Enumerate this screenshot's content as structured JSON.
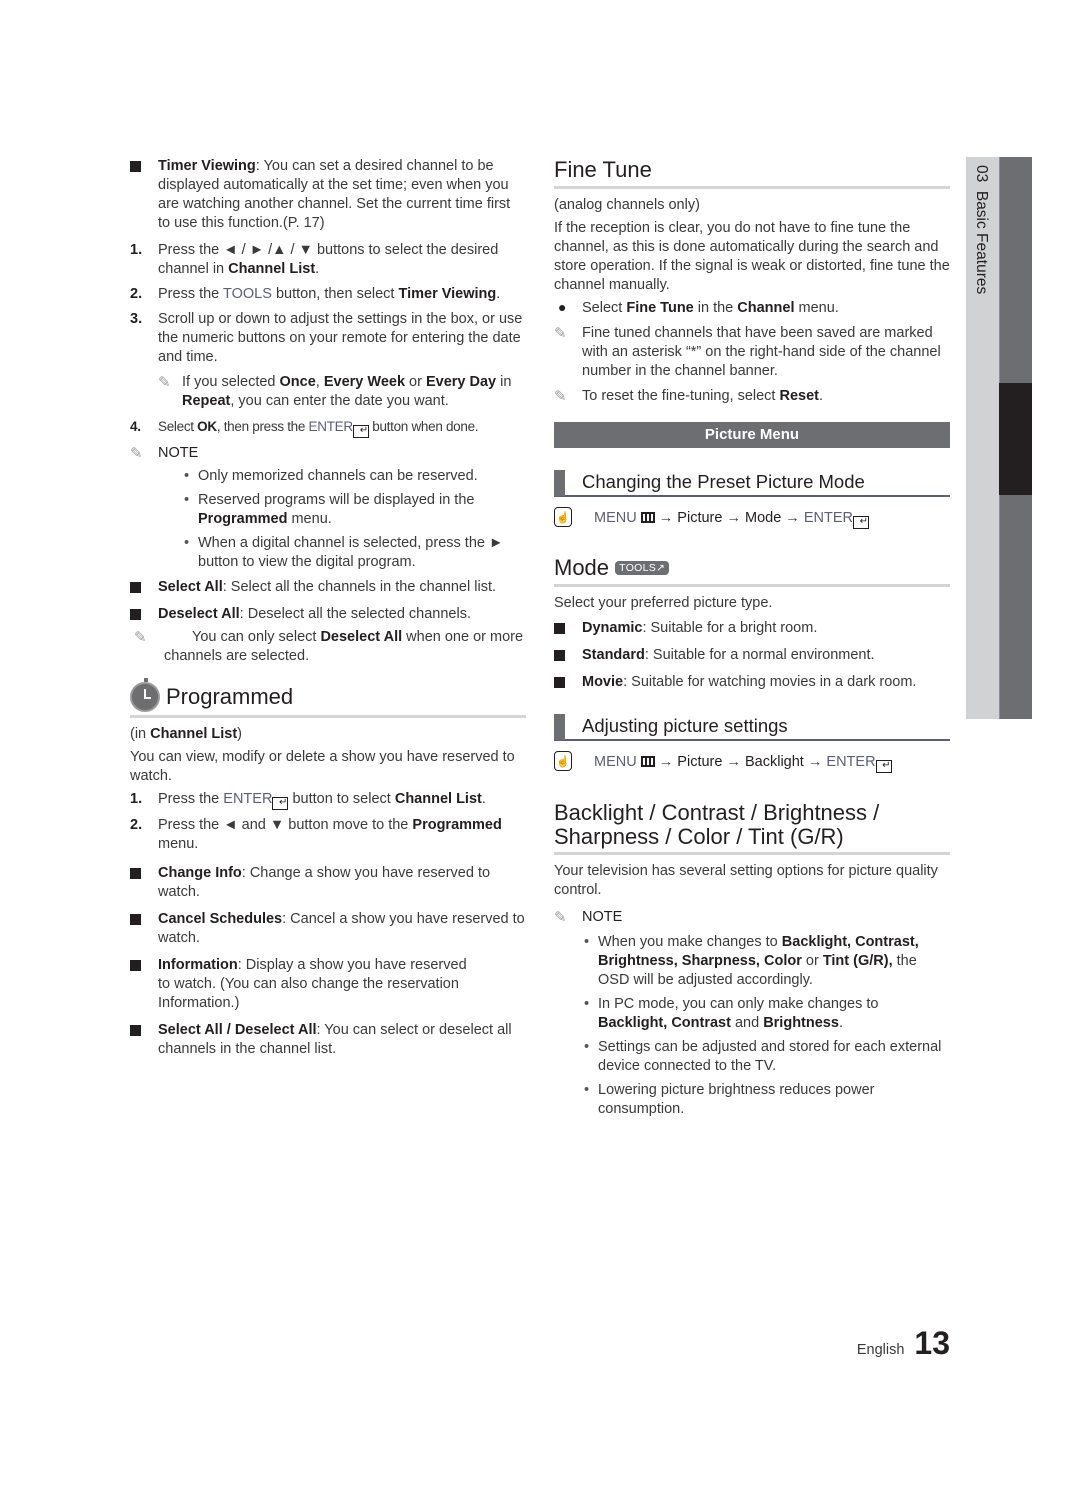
{
  "left": {
    "timer_viewing": {
      "term": "Timer Viewing",
      "desc": ": You can set a desired channel to be displayed automatically at the set time; even when you are watching another channel. Set the current time first to use this function.(P. 17)",
      "steps": [
        {
          "num": "1.",
          "pre": "Press the ◄ / ► /▲ / ▼ buttons to select the desired channel in ",
          "bold": "Channel List",
          "post": "."
        },
        {
          "num": "2.",
          "pre": "Press the ",
          "blue": "TOOLS",
          "mid": " button, then select ",
          "bold": "Timer Viewing",
          "post": "."
        },
        {
          "num": "3.",
          "text": "Scroll up or down to adjust the settings in the box, or use the numeric buttons on your remote for entering the date and time."
        },
        {
          "num": "4.",
          "pre": "Select ",
          "bold": "OK",
          "mid": ", then press the ",
          "blue": "ENTER",
          "post": " button when done."
        }
      ],
      "step3_note": {
        "pre": "If you selected ",
        "b1": "Once",
        "s1": ", ",
        "b2": "Every Week",
        "s2": " or ",
        "b3": "Every Day",
        "s3": " in ",
        "b4": "Repeat",
        "post": ", you can enter the date you want."
      },
      "note_title": "NOTE",
      "notes": [
        {
          "text": "Only memorized channels can be reserved."
        },
        {
          "pre": "Reserved programs will be displayed in the ",
          "bold": "Programmed",
          "post": " menu."
        },
        {
          "text": "When a digital channel is selected, press the ► button to view the digital program."
        }
      ]
    },
    "select_all": {
      "term": "Select All",
      "desc": ": Select all the channels in the channel list."
    },
    "deselect_all": {
      "term": "Deselect All",
      "desc": ": Deselect all the selected channels."
    },
    "deselect_note": {
      "pre": "You can only select ",
      "bold": "Deselect All",
      "post": " when one or more channels are selected."
    },
    "programmed": {
      "title": "Programmed",
      "context_pre": "(in ",
      "context_bold": "Channel List",
      "context_post": ")",
      "intro": "You can view, modify or delete a show you have reserved to watch.",
      "step1": {
        "num": "1.",
        "pre": "Press the ",
        "blue": "ENTER",
        "mid": " button to select ",
        "bold": "Channel List",
        "post": "."
      },
      "step2": {
        "num": "2.",
        "pre": "Press the ◄ and ▼ button move to the ",
        "bold": "Programmed",
        "post": " menu."
      },
      "items": [
        {
          "term": "Change Info",
          "desc": ": Change a show you have reserved to watch."
        },
        {
          "term": "Cancel Schedules",
          "desc": ": Cancel a show you have reserved to watch."
        },
        {
          "term": "Information",
          "desc": ": Display a show you have reserved to watch. (You can also change the reservation Information.)"
        },
        {
          "term": "Select All / Deselect All",
          "desc": ": You can select or deselect all channels in the channel list."
        }
      ]
    }
  },
  "right": {
    "fine_tune": {
      "title": "Fine Tune",
      "context": "(analog channels only)",
      "intro": "If the reception is clear, you do not have to fine tune the channel, as this is done automatically during the search and store operation. If the signal is weak or distorted, fine tune the channel manually.",
      "bullet": {
        "pre": "Select ",
        "b1": "Fine Tune",
        "mid": " in the ",
        "b2": "Channel",
        "post": " menu."
      },
      "note1": "Fine tuned channels that have been saved are marked with an asterisk “*” on the right-hand side of the channel number in the channel banner.",
      "note2": {
        "pre": "To reset the fine-tuning, select ",
        "bold": "Reset",
        "post": "."
      }
    },
    "banner": "Picture Menu",
    "preset": {
      "title": "Changing the Preset Picture Mode",
      "path": {
        "menu": "MENU",
        "arrow1": " → ",
        "p1": "Picture",
        "arrow2": " → ",
        "p2": "Mode",
        "arrow3": " → ",
        "enter": "ENTER"
      }
    },
    "mode": {
      "title": "Mode",
      "badge": "TOOLS",
      "intro": "Select your preferred picture type.",
      "items": [
        {
          "term": "Dynamic",
          "desc": ": Suitable for a bright room."
        },
        {
          "term": "Standard",
          "desc": ": Suitable for a normal environment."
        },
        {
          "term": "Movie",
          "desc": ": Suitable for watching movies in a dark room."
        }
      ]
    },
    "adjusting": {
      "title": "Adjusting picture settings",
      "path": {
        "menu": "MENU",
        "arrow1": " → ",
        "p1": "Picture",
        "arrow2": " → ",
        "p2": "Backlight",
        "arrow3": " → ",
        "enter": "ENTER"
      }
    },
    "backlight": {
      "title_line1": "Backlight / Contrast / Brightness /",
      "title_line2": "Sharpness / Color / Tint (G/R)",
      "intro": "Your television has several setting options for picture quality control.",
      "note_title": "NOTE",
      "note1": {
        "pre": "When you make changes to ",
        "b1": "Backlight, Contrast, Brightness, Sharpness, Color",
        "mid": " or ",
        "b2": "Tint (G/R),",
        "post": " the OSD will be adjusted accordingly."
      },
      "note2": {
        "pre": "In PC mode, you can only make changes to ",
        "b1": "Backlight, Contrast",
        "mid": " and ",
        "b2": "Brightness",
        "post": "."
      },
      "note3": "Settings can be adjusted and stored for each external device connected to the TV.",
      "note4": "Lowering picture brightness reduces power consumption."
    }
  },
  "side_tab": {
    "label": "03  Basic Features"
  },
  "footer": {
    "language": "English",
    "page": "13"
  }
}
